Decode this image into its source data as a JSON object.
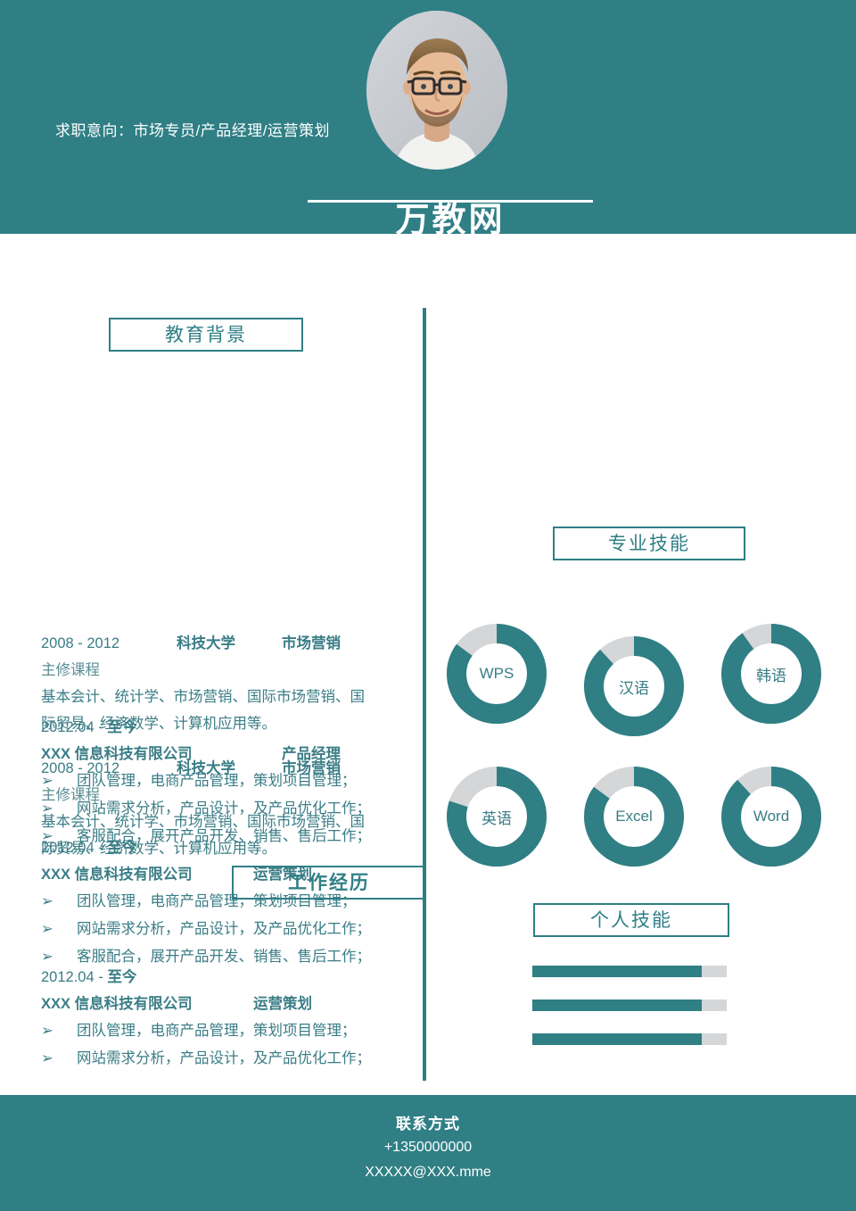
{
  "header": {
    "objective": "求职意向：市场专员/产品经理/运营策划",
    "logo": "万教网",
    "photo_alt": "portrait-photo"
  },
  "sections": {
    "education": "教育背景",
    "professional_skills": "专业技能",
    "personal_skills": "个人技能",
    "work_experience": "工作经历"
  },
  "education_entry": {
    "years": "2008 - 2012",
    "school": "科技大学",
    "major": "市场营销",
    "courses_label": "主修课程",
    "courses_line1": "基本会计、统计学、市场营销、国际市场营销、国",
    "courses_line2": "际贸易、经济数学、计算机应用等。"
  },
  "work_entries": [
    {
      "period_start": "2012.04 - ",
      "period_end": "至今",
      "company": "XXX 信息科技有限公司",
      "title": "产品经理",
      "bullets": [
        "团队管理，电商产品管理，策划项目管理；",
        "网站需求分析，产品设计，及产品优化工作；",
        "客服配合，展开产品开发、销售、售后工作；"
      ]
    },
    {
      "period_start": "2012.04 - ",
      "period_end": "至今",
      "company": "XXX 信息科技有限公司",
      "title": "运营策划",
      "bullets": [
        "团队管理，电商产品管理，策划项目管理；",
        "网站需求分析，产品设计，及产品优化工作；",
        "客服配合，展开产品开发、销售、售后工作；"
      ]
    },
    {
      "period_start": "2012.04 - ",
      "period_end": "至今",
      "company": "XXX 信息科技有限公司",
      "title": "运营策划",
      "bullets": [
        "团队管理，电商产品管理，策划项目管理；",
        "网站需求分析，产品设计，及产品优化工作；"
      ]
    }
  ],
  "bullet_marker": "➢",
  "chart_data": [
    {
      "type": "pie",
      "title": "专业技能",
      "subtype": "donut-gauge-set",
      "legend": "none",
      "items": [
        {
          "label": "WPS",
          "value": 85,
          "max": 100
        },
        {
          "label": "汉语",
          "value": 88,
          "max": 100
        },
        {
          "label": "韩语",
          "value": 90,
          "max": 100
        },
        {
          "label": "英语",
          "value": 80,
          "max": 100
        },
        {
          "label": "Excel",
          "value": 85,
          "max": 100
        },
        {
          "label": "Word",
          "value": 88,
          "max": 100
        }
      ],
      "colors": {
        "filled": "#2f7f85",
        "track": "#d4d6d8"
      }
    },
    {
      "type": "bar",
      "title": "个人技能",
      "subtype": "horizontal-progress",
      "categories": [
        "",
        "",
        ""
      ],
      "values": [
        87,
        87,
        87
      ],
      "xlim": [
        0,
        100
      ],
      "xlabel": "",
      "ylabel": "",
      "grid": false,
      "legend": "none",
      "colors": {
        "filled": "#2f7f85",
        "track": "#d4d6d8"
      }
    }
  ],
  "footer": {
    "title": "联系方式",
    "phone": "+1350000000",
    "email": "XXXXX@XXX.mme"
  },
  "colors": {
    "teal": "#2f7f85",
    "teal_text": "#3a7d86",
    "track_gray": "#d4d6d8",
    "white": "#ffffff"
  }
}
